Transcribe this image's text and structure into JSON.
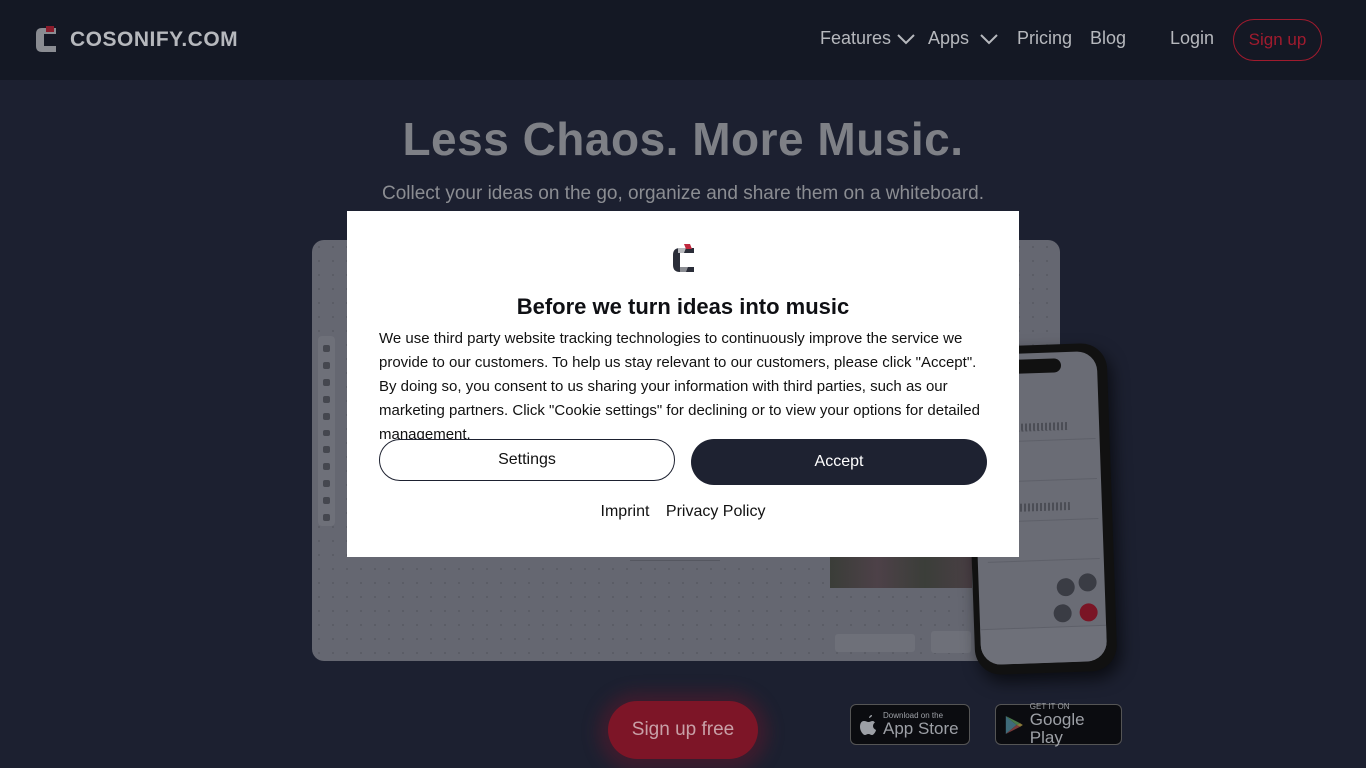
{
  "header": {
    "brand": "COSONIFY.COM",
    "nav": {
      "features": "Features",
      "apps": "Apps",
      "pricing": "Pricing",
      "blog": "Blog",
      "login": "Login",
      "signup": "Sign up"
    }
  },
  "hero": {
    "title": "Less Chaos. More Music.",
    "subtitle": "Collect your ideas on the go, organize and share them on a whiteboard."
  },
  "cta": {
    "label": "Sign up free"
  },
  "stores": {
    "apple_small": "Download on the",
    "apple_big": "App Store",
    "google_small": "GET IT ON",
    "google_big": "Google Play"
  },
  "modal": {
    "title": "Before we turn ideas into music",
    "body": "We use third party website tracking technologies to continuously improve the service we provide to our customers. To help us stay relevant to our customers, please click \"Accept\". By doing so, you consent to us sharing your information with third parties, such as our marketing partners. Click \"Cookie settings\" for declining or to view your options for detailed management.",
    "settings_label": "Settings",
    "accept_label": "Accept",
    "imprint_label": "Imprint",
    "privacy_label": "Privacy Policy"
  },
  "colors": {
    "brand_red": "#a01b2e",
    "dark_navy": "#1e2231",
    "page_bg": "#1c2030"
  }
}
